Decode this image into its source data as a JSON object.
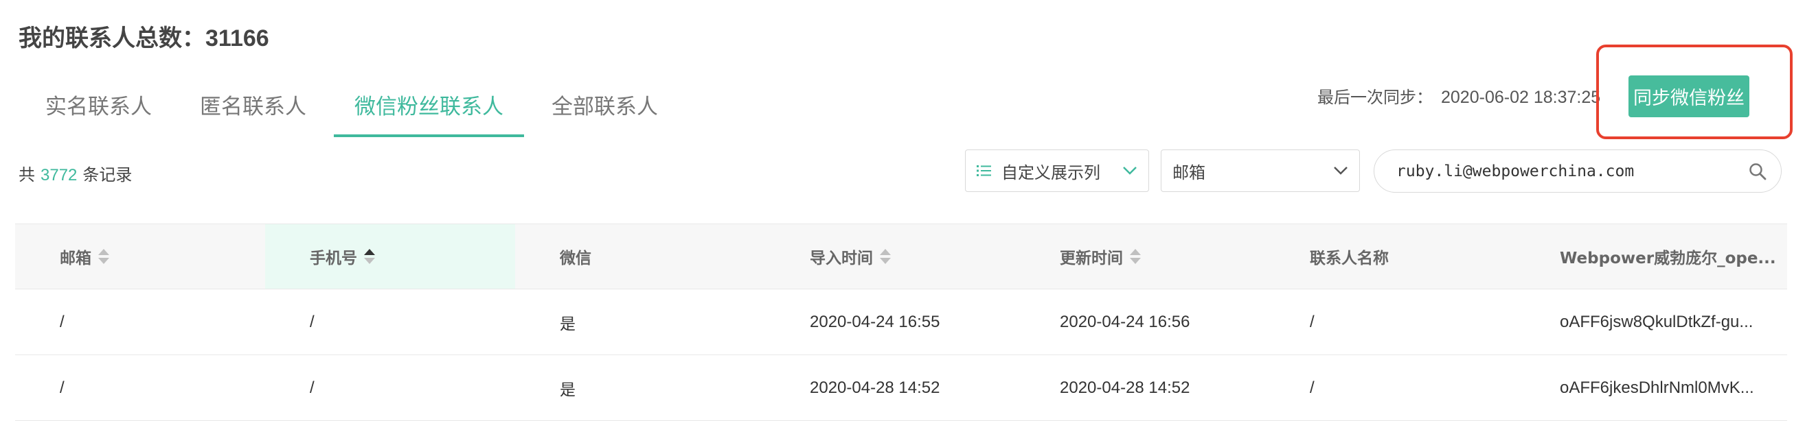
{
  "header": {
    "title_prefix": "我的联系人总数：",
    "total_contacts": "31166"
  },
  "tabs": [
    {
      "label": "实名联系人",
      "active": false
    },
    {
      "label": "匿名联系人",
      "active": false
    },
    {
      "label": "微信粉丝联系人",
      "active": true
    },
    {
      "label": "全部联系人",
      "active": false
    }
  ],
  "sync": {
    "label": "最后一次同步：",
    "timestamp": "2020-06-02 18:37:25",
    "button_label": "同步微信粉丝"
  },
  "records": {
    "prefix": "共",
    "count": "3772",
    "suffix": "条记录"
  },
  "toolbar": {
    "custom_columns_label": "自定义展示列",
    "field_select_value": "邮箱",
    "search_value": "ruby.li@webpowerchina.com"
  },
  "table": {
    "columns": [
      "邮箱",
      "手机号",
      "微信",
      "导入时间",
      "更新时间",
      "联系人名称",
      "Webpower威勃庞尔_ope..."
    ],
    "rows": [
      [
        "/",
        "/",
        "是",
        "2020-04-24 16:55",
        "2020-04-24 16:56",
        "/",
        "oAFF6jsw8QkulDtkZf-gu..."
      ],
      [
        "/",
        "/",
        "是",
        "2020-04-28 14:52",
        "2020-04-28 14:52",
        "/",
        "oAFF6jkesDhlrNml0MvK..."
      ]
    ]
  },
  "colors": {
    "accent": "#3fb99d",
    "button": "#47bc9c",
    "highlight_box": "#e8402e"
  }
}
